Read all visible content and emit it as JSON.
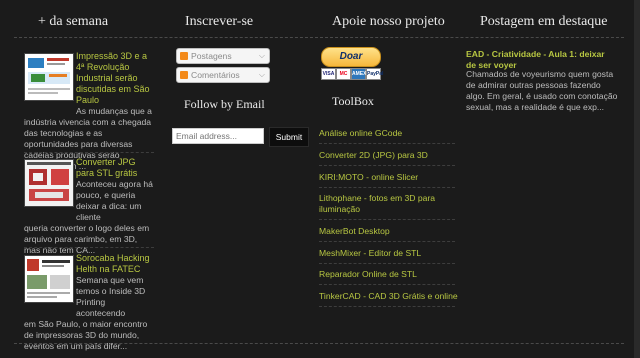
{
  "columns": {
    "popular": {
      "title": "+ da semana"
    },
    "subscribe": {
      "title": "Inscrever-se"
    },
    "support": {
      "title": "Apoie nosso projeto"
    },
    "featured": {
      "title": "Postagem em destaque"
    }
  },
  "popular_posts": [
    {
      "title": "Impressão 3D e a 4ª Revolução Industrial serão discutidas em São Paulo",
      "snippet_lead": "As mudanças que a",
      "snippet_rest": "indústria vivencia com a chegada das tecnologias e as oportunidades para diversas cadeias produtivas serão discutidas em ..."
    },
    {
      "title": "Converter JPG para STL grátis",
      "snippet_lead": "Aconteceu agora há pouco, e queria deixar a dica: um cliente",
      "snippet_rest": "queria converter o logo deles em arquivo para carimbo, em 3D, mas não tem CA..."
    },
    {
      "title": "Sorocaba Hacking Helth na FATEC",
      "snippet_lead": "Semana que vem temos o Inside 3D Printing acontecendo",
      "snippet_rest": "em São Paulo, o maior encontro de impressoras 3D do mundo, eventos em um país difer..."
    }
  ],
  "subscribe": {
    "posts_label": "Postagens",
    "comments_label": "Comentários",
    "follow_title": "Follow by Email",
    "email_placeholder": "Email address...",
    "submit_label": "Submit"
  },
  "donate": {
    "button_label": "Doar",
    "cards": [
      "VISA",
      "MC",
      "AMEX",
      "PayPal"
    ]
  },
  "toolbox": {
    "title": "ToolBox",
    "links": [
      "Análise online GCode",
      "Converter 2D (JPG) para 3D",
      "KIRI:MOTO - online Slicer",
      "Lithophane - fotos em 3D para iluminação",
      "MakerBot Desktop",
      "MeshMixer - Editor de STL",
      "Reparador Online de STL",
      "TinkerCAD - CAD 3D Grátis e online"
    ]
  },
  "featured": {
    "post_title": "EAD - Criatividade - Aula 1: deixar de ser voyer",
    "post_text": "Chamados de voyeurismo quem gosta de admirar outras pessoas fazendo algo. Em geral, é usado com conotação sexual, mas a realidade é que exp..."
  }
}
